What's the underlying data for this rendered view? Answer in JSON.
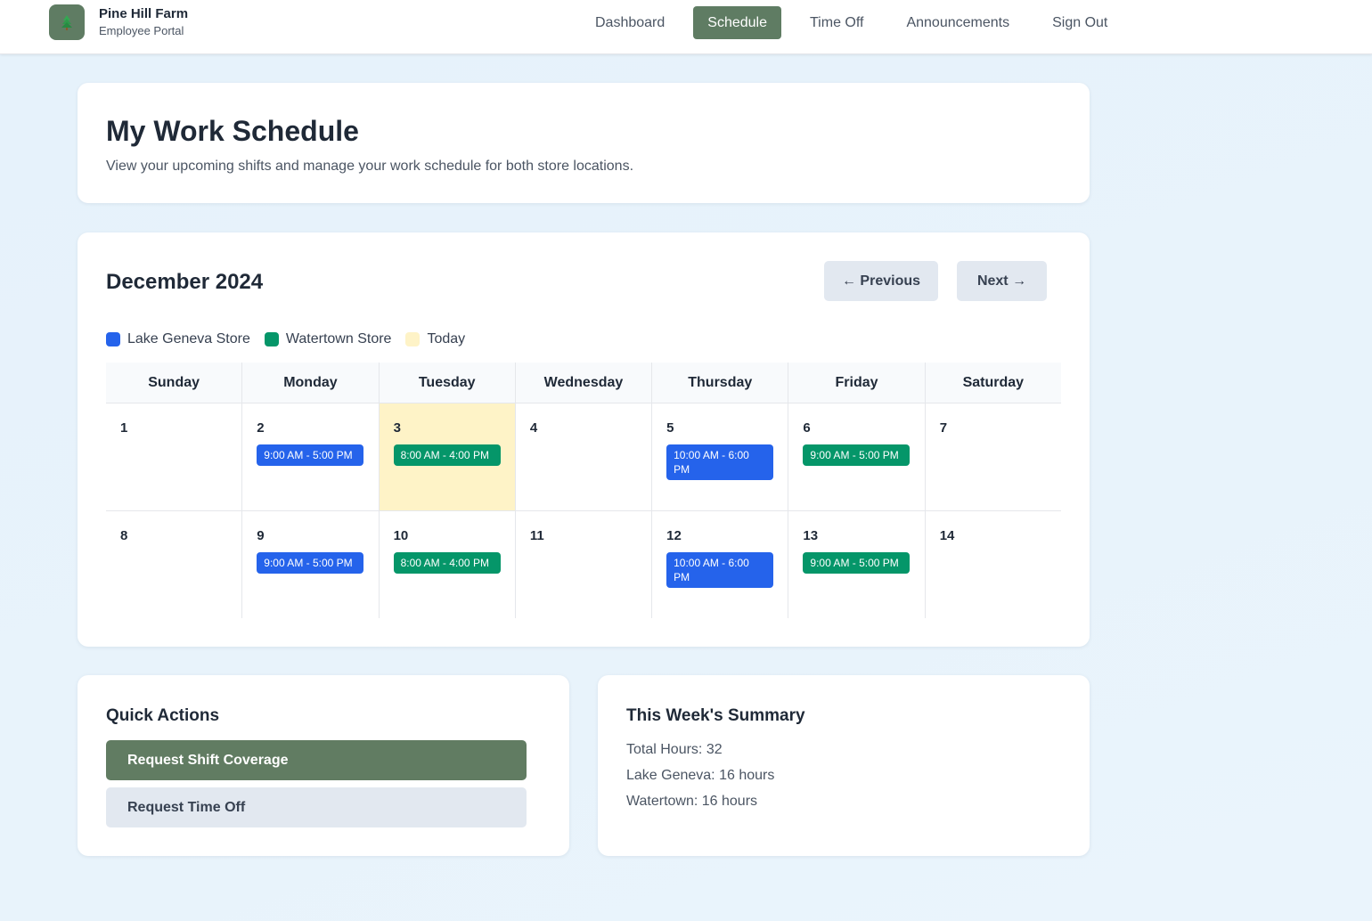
{
  "brand": {
    "name": "Pine Hill Farm",
    "subtitle": "Employee Portal",
    "logo_icon": "pine-tree-icon"
  },
  "nav": [
    {
      "label": "Dashboard",
      "active": false
    },
    {
      "label": "Schedule",
      "active": true
    },
    {
      "label": "Time Off",
      "active": false
    },
    {
      "label": "Announcements",
      "active": false
    },
    {
      "label": "Sign Out",
      "active": false
    }
  ],
  "page": {
    "title": "My Work Schedule",
    "subtitle": "View your upcoming shifts and manage your work schedule for both store locations."
  },
  "calendar": {
    "month": "December 2024",
    "prev_label": "← Previous",
    "next_label": "Next →",
    "legend": [
      {
        "label": "Lake Geneva Store",
        "color": "#2563eb"
      },
      {
        "label": "Watertown Store",
        "color": "#059669"
      },
      {
        "label": "Today",
        "color": "#fef3c7"
      }
    ],
    "weekdays": [
      "Sunday",
      "Monday",
      "Tuesday",
      "Wednesday",
      "Thursday",
      "Friday",
      "Saturday"
    ],
    "weeks": [
      [
        {
          "day": "1",
          "today": false,
          "shift": null
        },
        {
          "day": "2",
          "today": false,
          "shift": {
            "time": "9:00 AM - 5:00 PM",
            "store": "lake"
          }
        },
        {
          "day": "3",
          "today": true,
          "shift": {
            "time": "8:00 AM - 4:00 PM",
            "store": "water"
          }
        },
        {
          "day": "4",
          "today": false,
          "shift": null
        },
        {
          "day": "5",
          "today": false,
          "shift": {
            "time": "10:00 AM - 6:00 PM",
            "store": "lake"
          }
        },
        {
          "day": "6",
          "today": false,
          "shift": {
            "time": "9:00 AM - 5:00 PM",
            "store": "water"
          }
        },
        {
          "day": "7",
          "today": false,
          "shift": null
        }
      ],
      [
        {
          "day": "8",
          "today": false,
          "shift": null
        },
        {
          "day": "9",
          "today": false,
          "shift": {
            "time": "9:00 AM - 5:00 PM",
            "store": "lake"
          }
        },
        {
          "day": "10",
          "today": false,
          "shift": {
            "time": "8:00 AM - 4:00 PM",
            "store": "water"
          }
        },
        {
          "day": "11",
          "today": false,
          "shift": null
        },
        {
          "day": "12",
          "today": false,
          "shift": {
            "time": "10:00 AM - 6:00 PM",
            "store": "lake"
          }
        },
        {
          "day": "13",
          "today": false,
          "shift": {
            "time": "9:00 AM - 5:00 PM",
            "store": "water"
          }
        },
        {
          "day": "14",
          "today": false,
          "shift": null
        }
      ]
    ]
  },
  "quick_actions": {
    "title": "Quick Actions",
    "primary_label": "Request Shift Coverage",
    "secondary_label": "Request Time Off"
  },
  "summary": {
    "title": "This Week's Summary",
    "total": "Total Hours: 32",
    "lake": "Lake Geneva: 16 hours",
    "water": "Watertown: 16 hours"
  }
}
